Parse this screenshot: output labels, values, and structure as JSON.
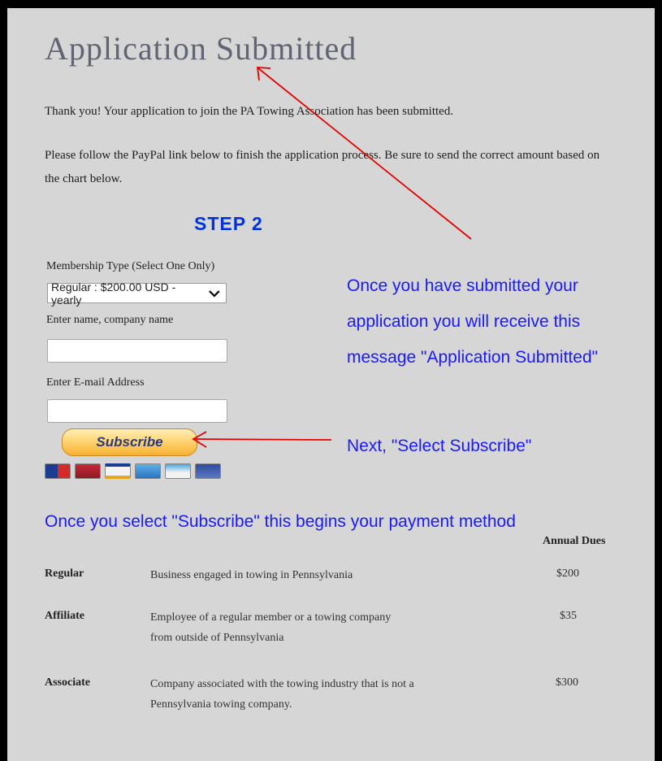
{
  "page": {
    "title": "Application Submitted",
    "thank_you": "Thank you! Your application to join the PA Towing Association has been submitted.",
    "instructions": "Please follow the PayPal link below to finish the application process. Be sure to send the correct amount based on the chart below.",
    "step_label": "STEP 2"
  },
  "form": {
    "membership_label": "Membership Type (Select One Only)",
    "membership_selected": "Regular : $200.00 USD - yearly",
    "name_label": "Enter name, company name",
    "name_value": "",
    "email_label": "Enter E-mail Address",
    "email_value": "",
    "subscribe_label": "Subscribe"
  },
  "cards": [
    "mastercard",
    "discover",
    "visa",
    "amex",
    "echeck",
    "bank"
  ],
  "annotations": {
    "submitted_line1": "Once you have submitted your",
    "submitted_line2": "application you will receive this",
    "submitted_line3": "message \"Application Submitted\"",
    "subscribe_hint": "Next, \"Select Subscribe\"",
    "payment_hint": "Once you select \"Subscribe\" this begins your payment method"
  },
  "dues_table": {
    "header": "Annual Dues",
    "rows": [
      {
        "name": "Regular",
        "desc_line1": "Business engaged in towing in Pennsylvania",
        "desc_line2": "",
        "price": "$200"
      },
      {
        "name": "Affiliate",
        "desc_line1": "Employee of a regular member or a towing company",
        "desc_line2": "from outside of Pennsylvania",
        "price": "$35"
      },
      {
        "name": "Associate",
        "desc_line1": "Company associated with the towing industry that is not a",
        "desc_line2": "Pennsylvania towing company.",
        "price": "$300"
      }
    ]
  },
  "colors": {
    "annotation_blue": "#1a1aff",
    "step_blue": "#0033dd",
    "arrow_red": "#e60000",
    "background_gray": "#d6d6d6"
  }
}
